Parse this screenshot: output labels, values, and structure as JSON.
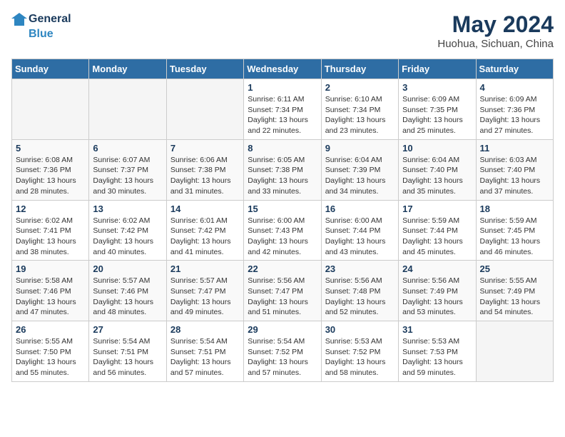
{
  "header": {
    "logo_line1": "General",
    "logo_line2": "Blue",
    "month": "May 2024",
    "location": "Huohua, Sichuan, China"
  },
  "weekdays": [
    "Sunday",
    "Monday",
    "Tuesday",
    "Wednesday",
    "Thursday",
    "Friday",
    "Saturday"
  ],
  "weeks": [
    [
      {
        "day": "",
        "info": ""
      },
      {
        "day": "",
        "info": ""
      },
      {
        "day": "",
        "info": ""
      },
      {
        "day": "1",
        "info": "Sunrise: 6:11 AM\nSunset: 7:34 PM\nDaylight: 13 hours\nand 22 minutes."
      },
      {
        "day": "2",
        "info": "Sunrise: 6:10 AM\nSunset: 7:34 PM\nDaylight: 13 hours\nand 23 minutes."
      },
      {
        "day": "3",
        "info": "Sunrise: 6:09 AM\nSunset: 7:35 PM\nDaylight: 13 hours\nand 25 minutes."
      },
      {
        "day": "4",
        "info": "Sunrise: 6:09 AM\nSunset: 7:36 PM\nDaylight: 13 hours\nand 27 minutes."
      }
    ],
    [
      {
        "day": "5",
        "info": "Sunrise: 6:08 AM\nSunset: 7:36 PM\nDaylight: 13 hours\nand 28 minutes."
      },
      {
        "day": "6",
        "info": "Sunrise: 6:07 AM\nSunset: 7:37 PM\nDaylight: 13 hours\nand 30 minutes."
      },
      {
        "day": "7",
        "info": "Sunrise: 6:06 AM\nSunset: 7:38 PM\nDaylight: 13 hours\nand 31 minutes."
      },
      {
        "day": "8",
        "info": "Sunrise: 6:05 AM\nSunset: 7:38 PM\nDaylight: 13 hours\nand 33 minutes."
      },
      {
        "day": "9",
        "info": "Sunrise: 6:04 AM\nSunset: 7:39 PM\nDaylight: 13 hours\nand 34 minutes."
      },
      {
        "day": "10",
        "info": "Sunrise: 6:04 AM\nSunset: 7:40 PM\nDaylight: 13 hours\nand 35 minutes."
      },
      {
        "day": "11",
        "info": "Sunrise: 6:03 AM\nSunset: 7:40 PM\nDaylight: 13 hours\nand 37 minutes."
      }
    ],
    [
      {
        "day": "12",
        "info": "Sunrise: 6:02 AM\nSunset: 7:41 PM\nDaylight: 13 hours\nand 38 minutes."
      },
      {
        "day": "13",
        "info": "Sunrise: 6:02 AM\nSunset: 7:42 PM\nDaylight: 13 hours\nand 40 minutes."
      },
      {
        "day": "14",
        "info": "Sunrise: 6:01 AM\nSunset: 7:42 PM\nDaylight: 13 hours\nand 41 minutes."
      },
      {
        "day": "15",
        "info": "Sunrise: 6:00 AM\nSunset: 7:43 PM\nDaylight: 13 hours\nand 42 minutes."
      },
      {
        "day": "16",
        "info": "Sunrise: 6:00 AM\nSunset: 7:44 PM\nDaylight: 13 hours\nand 43 minutes."
      },
      {
        "day": "17",
        "info": "Sunrise: 5:59 AM\nSunset: 7:44 PM\nDaylight: 13 hours\nand 45 minutes."
      },
      {
        "day": "18",
        "info": "Sunrise: 5:59 AM\nSunset: 7:45 PM\nDaylight: 13 hours\nand 46 minutes."
      }
    ],
    [
      {
        "day": "19",
        "info": "Sunrise: 5:58 AM\nSunset: 7:46 PM\nDaylight: 13 hours\nand 47 minutes."
      },
      {
        "day": "20",
        "info": "Sunrise: 5:57 AM\nSunset: 7:46 PM\nDaylight: 13 hours\nand 48 minutes."
      },
      {
        "day": "21",
        "info": "Sunrise: 5:57 AM\nSunset: 7:47 PM\nDaylight: 13 hours\nand 49 minutes."
      },
      {
        "day": "22",
        "info": "Sunrise: 5:56 AM\nSunset: 7:47 PM\nDaylight: 13 hours\nand 51 minutes."
      },
      {
        "day": "23",
        "info": "Sunrise: 5:56 AM\nSunset: 7:48 PM\nDaylight: 13 hours\nand 52 minutes."
      },
      {
        "day": "24",
        "info": "Sunrise: 5:56 AM\nSunset: 7:49 PM\nDaylight: 13 hours\nand 53 minutes."
      },
      {
        "day": "25",
        "info": "Sunrise: 5:55 AM\nSunset: 7:49 PM\nDaylight: 13 hours\nand 54 minutes."
      }
    ],
    [
      {
        "day": "26",
        "info": "Sunrise: 5:55 AM\nSunset: 7:50 PM\nDaylight: 13 hours\nand 55 minutes."
      },
      {
        "day": "27",
        "info": "Sunrise: 5:54 AM\nSunset: 7:51 PM\nDaylight: 13 hours\nand 56 minutes."
      },
      {
        "day": "28",
        "info": "Sunrise: 5:54 AM\nSunset: 7:51 PM\nDaylight: 13 hours\nand 57 minutes."
      },
      {
        "day": "29",
        "info": "Sunrise: 5:54 AM\nSunset: 7:52 PM\nDaylight: 13 hours\nand 57 minutes."
      },
      {
        "day": "30",
        "info": "Sunrise: 5:53 AM\nSunset: 7:52 PM\nDaylight: 13 hours\nand 58 minutes."
      },
      {
        "day": "31",
        "info": "Sunrise: 5:53 AM\nSunset: 7:53 PM\nDaylight: 13 hours\nand 59 minutes."
      },
      {
        "day": "",
        "info": ""
      }
    ]
  ]
}
